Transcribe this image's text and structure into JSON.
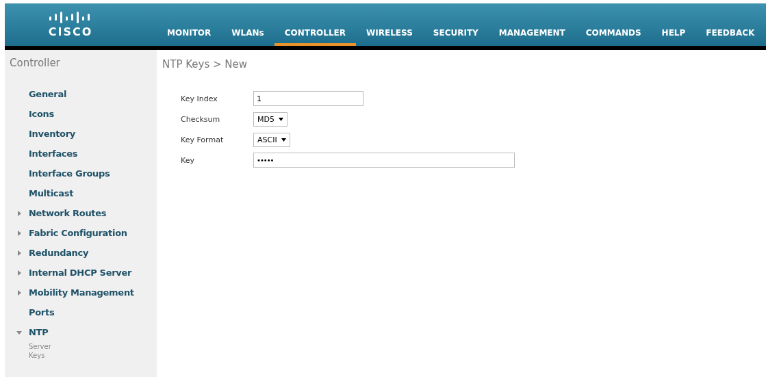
{
  "nav": [
    {
      "label": "MONITOR",
      "selected": false
    },
    {
      "label": "WLANs",
      "selected": false
    },
    {
      "label": "CONTROLLER",
      "selected": true
    },
    {
      "label": "WIRELESS",
      "selected": false
    },
    {
      "label": "SECURITY",
      "selected": false
    },
    {
      "label": "MANAGEMENT",
      "selected": false
    },
    {
      "label": "COMMANDS",
      "selected": false
    },
    {
      "label": "HELP",
      "selected": false
    },
    {
      "label": "FEEDBACK",
      "selected": false
    }
  ],
  "logo": {
    "wordmark": "CISCO"
  },
  "sidebar": {
    "title": "Controller",
    "items": [
      {
        "label": "General",
        "kind": "link"
      },
      {
        "label": "Icons",
        "kind": "link"
      },
      {
        "label": "Inventory",
        "kind": "link"
      },
      {
        "label": "Interfaces",
        "kind": "link"
      },
      {
        "label": "Interface Groups",
        "kind": "link"
      },
      {
        "label": "Multicast",
        "kind": "link"
      },
      {
        "label": "Network Routes",
        "kind": "group",
        "expanded": false
      },
      {
        "label": "Fabric Configuration",
        "kind": "group",
        "expanded": false
      },
      {
        "label": "Redundancy",
        "kind": "group",
        "expanded": false
      },
      {
        "label": "Internal DHCP Server",
        "kind": "group",
        "expanded": false
      },
      {
        "label": "Mobility Management",
        "kind": "group",
        "expanded": false
      },
      {
        "label": "Ports",
        "kind": "link"
      },
      {
        "label": "NTP",
        "kind": "group",
        "expanded": true,
        "children": [
          {
            "label": "Server"
          },
          {
            "label": "Keys"
          }
        ]
      }
    ]
  },
  "page": {
    "title": "NTP Keys > New",
    "fields": [
      {
        "label": "Key Index",
        "kind": "text",
        "value": "1"
      },
      {
        "label": "Checksum",
        "kind": "select",
        "value": "MD5"
      },
      {
        "label": "Key Format",
        "kind": "select",
        "value": "ASCII"
      },
      {
        "label": "Key",
        "kind": "password",
        "value": "•••••"
      }
    ]
  }
}
